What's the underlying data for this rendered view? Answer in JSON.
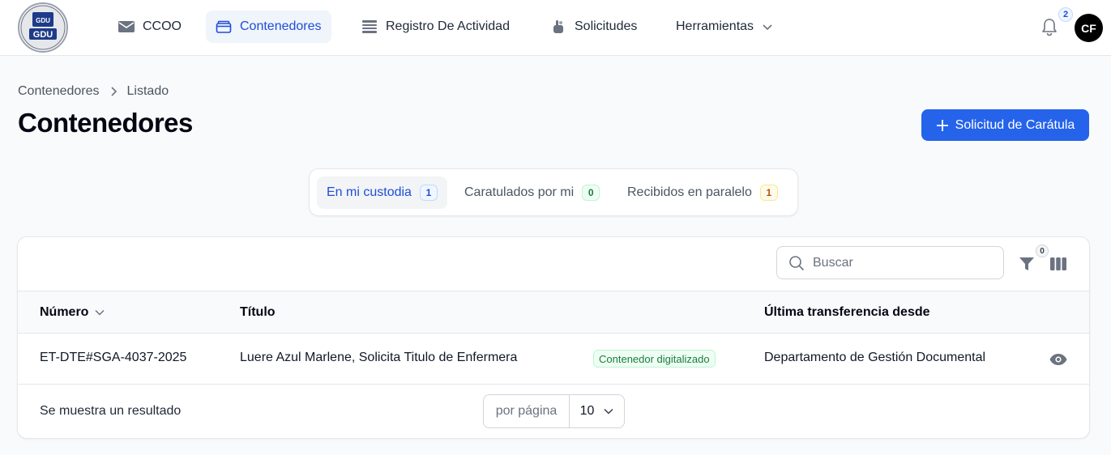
{
  "app": {
    "logo_text": "GDU"
  },
  "nav": {
    "items": [
      {
        "label": "CCOO",
        "icon": "envelope-icon"
      },
      {
        "label": "Contenedores",
        "icon": "folder-icon"
      },
      {
        "label": "Registro De Actividad",
        "icon": "list-icon"
      },
      {
        "label": "Solicitudes",
        "icon": "hand-icon"
      },
      {
        "label": "Herramientas",
        "icon": "chevron-down-icon"
      }
    ],
    "active": "Contenedores",
    "notifications_count": "2",
    "avatar_initials": "CF"
  },
  "breadcrumb": {
    "items": [
      "Contenedores",
      "Listado"
    ]
  },
  "page": {
    "title": "Contenedores",
    "primary_action": "Solicitud de Carátula"
  },
  "tabs": [
    {
      "label": "En mi custodia",
      "count": "1",
      "active": true
    },
    {
      "label": "Caratulados por mi",
      "count": "0"
    },
    {
      "label": "Recibidos en paralelo",
      "count": "1"
    }
  ],
  "table": {
    "search_placeholder": "Buscar",
    "filter_count": "0",
    "columns": [
      "Número",
      "Título",
      "Última transferencia desde"
    ],
    "rows": [
      {
        "numero": "ET-DTE#SGA-4037-2025",
        "titulo": "Luere Azul Marlene, Solicita Titulo de Enfermera",
        "badge": "Contenedor digitalizado",
        "ultima_transferencia": "Departamento de Gestión Documental"
      }
    ],
    "results_text": "Se muestra un resultado",
    "per_page_label": "por página",
    "per_page_value": "10"
  },
  "colors": {
    "primary": "#2563eb",
    "active_nav_text": "#1d4ed8",
    "success": "#15803d"
  }
}
